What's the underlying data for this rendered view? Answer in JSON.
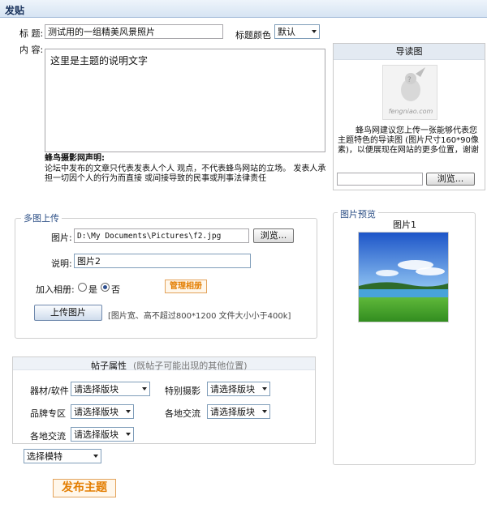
{
  "header": {
    "title": "发贴"
  },
  "post": {
    "title_label": "标 题:",
    "title_value": "测试用的一组精美风景照片",
    "title_color_label": "标题颜色",
    "title_color_value": "默认",
    "content_label": "内 容:",
    "content_value": "这里是主题的说明文字",
    "disclaimer_head": "蜂鸟摄影网声明:",
    "disclaimer_body": "论坛中发布的文章只代表发表人个人 观点，不代表蜂鸟网站的立场。 发表人承担一切因个人的行为而直接 或间接导致的民事或刑事法律责任"
  },
  "guide": {
    "head": "导读图",
    "watermark": "fengniao.com",
    "text": "蜂鸟网建议您上传一张能够代表您主题特色的导读图 (图片尺寸160*90像素)，以便展现在网站的更多位置，谢谢",
    "browse_label": "浏览..."
  },
  "multi_upload": {
    "legend": "多图上传",
    "image_label": "图片:",
    "image_path": "D:\\My Documents\\Pictures\\f2.jpg",
    "browse_label": "浏览...",
    "desc_label": "说明:",
    "desc_value": "图片2",
    "album_label": "加入相册:",
    "yes_label": "是",
    "no_label": "否",
    "manage_album_label": "管理相册",
    "upload_label": "上传图片",
    "hint": "[图片宽、高不超过800*1200 文件大小小于400k]"
  },
  "preview": {
    "legend": "图片预览",
    "caption": "图片1"
  },
  "attrs": {
    "title": "帖子属性",
    "subtitle": "(既帖子可能出现的其他位置)",
    "items": [
      {
        "label": "器材/软件",
        "value": "请选择版块"
      },
      {
        "label": "特别摄影",
        "value": "请选择版块"
      },
      {
        "label": "品牌专区",
        "value": "请选择版块"
      },
      {
        "label": "各地交流",
        "value": "请选择版块"
      },
      {
        "label": "各地交流",
        "value": "请选择版块"
      }
    ],
    "model_select": "选择模特"
  },
  "publish_label": "发布主题",
  "colors": {
    "accent": "#e37d00",
    "link": "#2c4f86",
    "header_bg": "#d6e4f3"
  }
}
